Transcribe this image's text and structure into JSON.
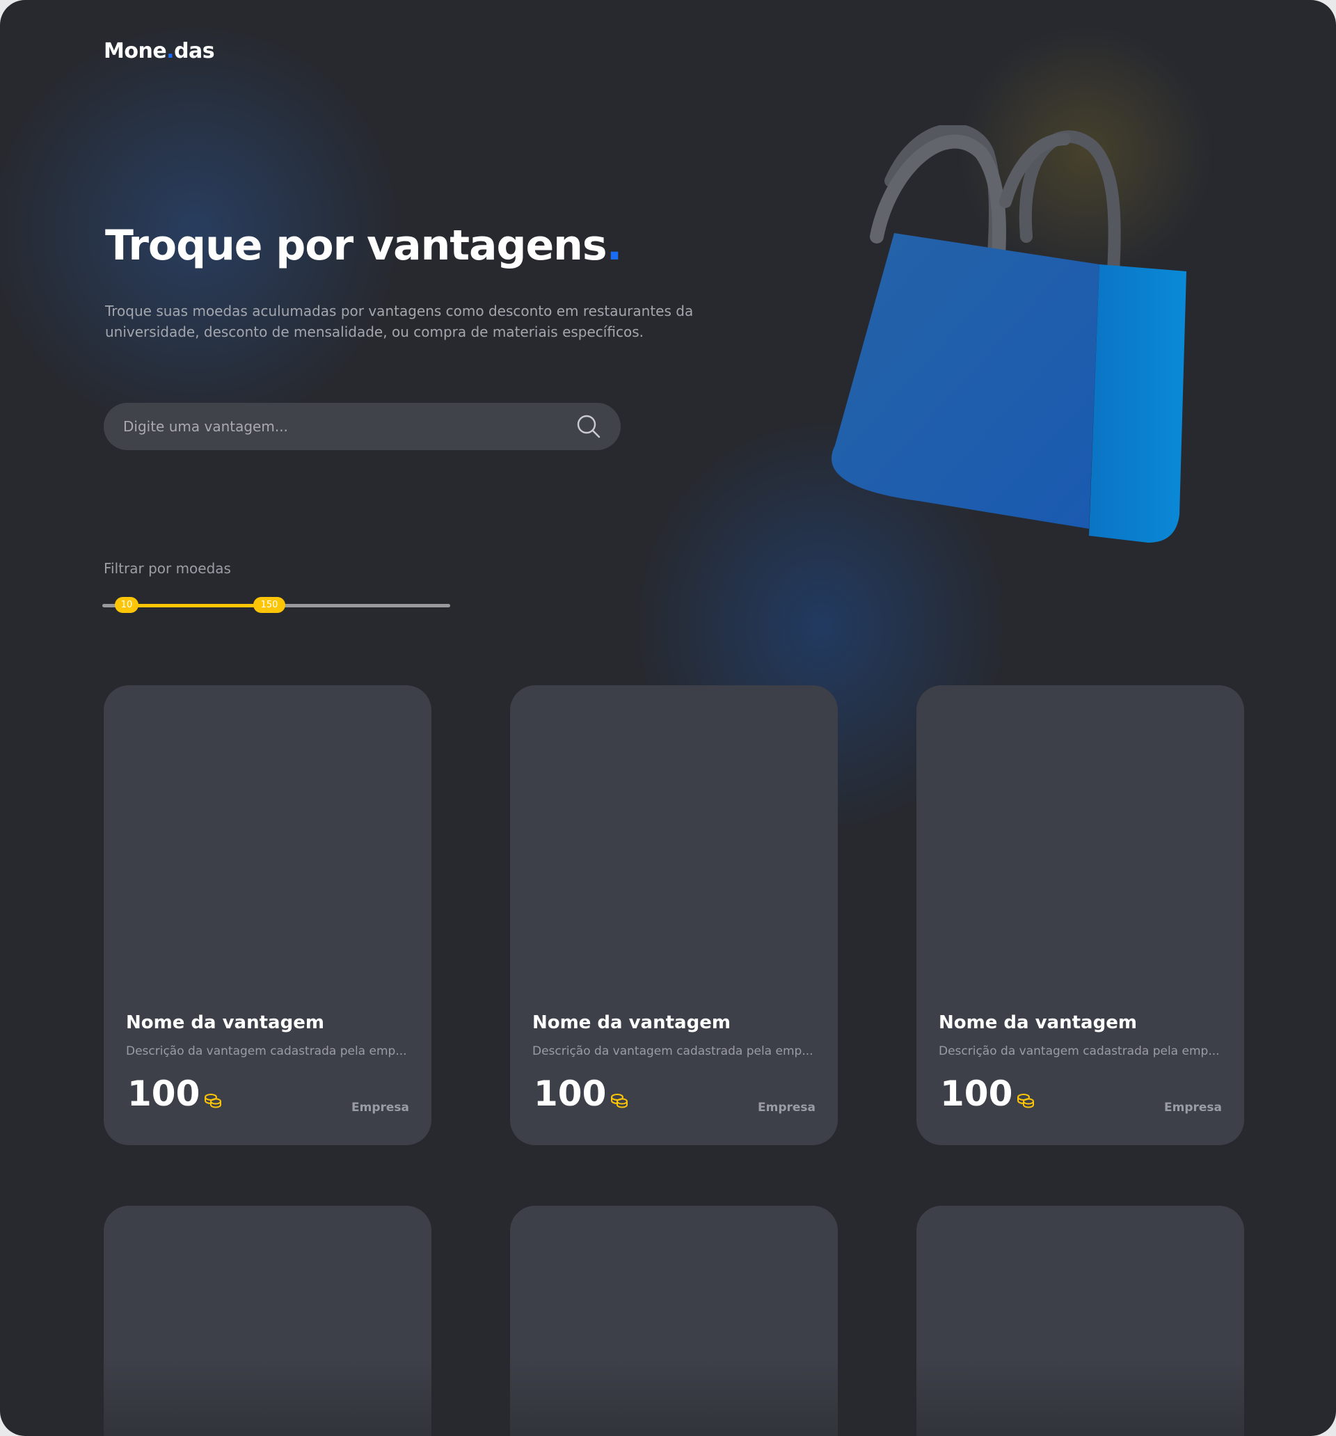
{
  "brand": {
    "name_a": "Mone",
    "dot": ".",
    "name_b": "das"
  },
  "hero": {
    "title": "Troque por vantagens",
    "title_dot": ".",
    "description": "Troque suas moedas aculumadas por vantagens como desconto em restaurantes da universidade, desconto de mensalidade, ou compra de materiais específicos."
  },
  "search": {
    "placeholder": "Digite uma vantagem...",
    "icon": "search-icon"
  },
  "filter": {
    "label": "Filtrar por moedas",
    "min_value": "10",
    "max_value": "150",
    "slider_fill_start_pct": 7,
    "slider_fill_end_pct": 48
  },
  "colors": {
    "accent": "#1a6cf5",
    "coin": "#fcc506",
    "card": "#3e4049",
    "background": "#27292f"
  },
  "cards": [
    {
      "title": "Nome da vantagem",
      "description": "Descrição da vantagem cadastrada pela emp...",
      "price": "100",
      "company": "Empresa"
    },
    {
      "title": "Nome da vantagem",
      "description": "Descrição da vantagem cadastrada pela emp...",
      "price": "100",
      "company": "Empresa"
    },
    {
      "title": "Nome da vantagem",
      "description": "Descrição da vantagem cadastrada pela emp...",
      "price": "100",
      "company": "Empresa"
    }
  ]
}
